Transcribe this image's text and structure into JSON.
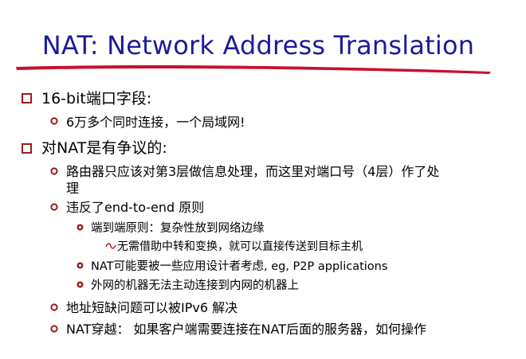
{
  "slide": {
    "title": "NAT: Network Address Translation",
    "items": [
      {
        "level": 1,
        "text": "16-bit端口字段:"
      },
      {
        "level": 2,
        "text": "6万多个同时连接，一个局域网!"
      },
      {
        "level": 1,
        "text": "对NAT是有争议的:"
      },
      {
        "level": 2,
        "text": "路由器只应该对第3层做信息处理，而这里对端口号（4层）作了处",
        "cont": "理"
      },
      {
        "level": 2,
        "text": "违反了end-to-end 原则"
      },
      {
        "level": 3,
        "text": "端到端原则：复杂性放到网络边缘"
      },
      {
        "level": 4,
        "text": "无需借助中转和变换，就可以直接传送到目标主机"
      },
      {
        "level": 3,
        "text": "NAT可能要被一些应用设计者考虑, eg, P2P applications"
      },
      {
        "level": 3,
        "text": "外网的机器无法主动连接到内网的机器上"
      },
      {
        "level": 2,
        "text": "地址短缺问题可以被IPv6 解决"
      },
      {
        "level": 2,
        "text": "NAT穿越： 如果客户端需要连接在NAT后面的服务器，如何操作"
      }
    ]
  },
  "colors": {
    "title": "#1c1c98",
    "underline": "#c8102e",
    "bullet": "#9b1b1b"
  }
}
